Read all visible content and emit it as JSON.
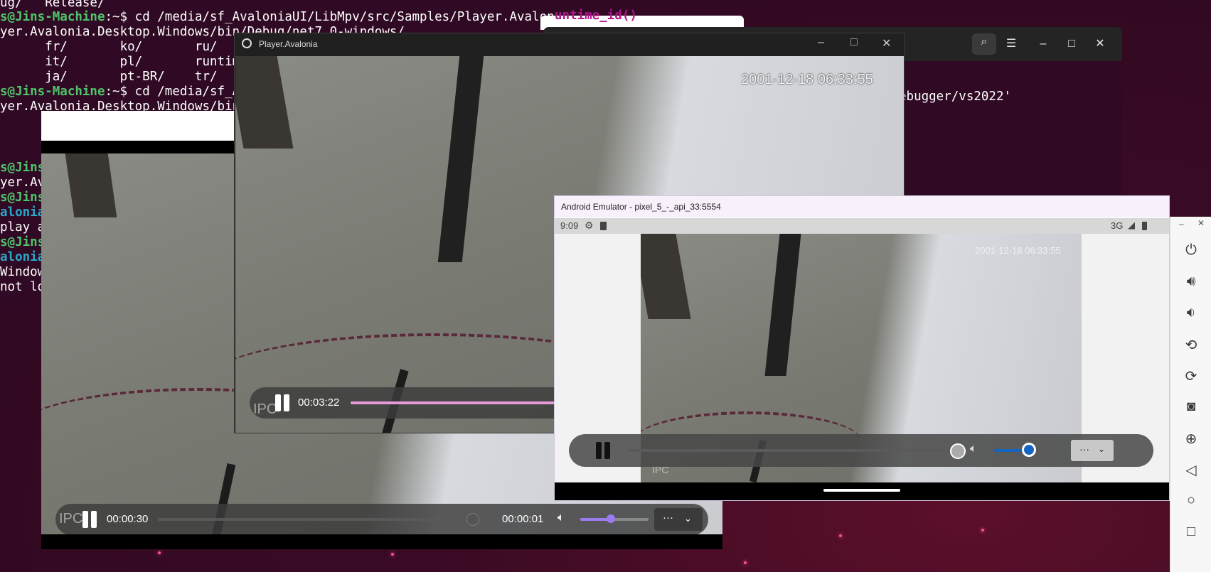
{
  "terminal": {
    "lines": [
      {
        "pre": "ug/   Release/",
        "user": "",
        "rest": ""
      },
      {
        "pre": "",
        "user": "s@Jins-Machine",
        "rest": ":~$ cd /media/sf_AvaloniaUI/LibMpv/src/Samples/Player.Avalonia/"
      },
      {
        "pre": "yer.Avalonia.Desktop.Windows/bin/Debug/net7.0-windows/",
        "user": "",
        "rest": ""
      },
      {
        "pre": "      fr/       ko/       ru/",
        "user": "",
        "rest": ""
      },
      {
        "pre": "      it/       pl/       runtime",
        "user": "",
        "rest": ""
      },
      {
        "pre": "      ja/       pt-BR/    tr/",
        "user": "",
        "rest": ""
      },
      {
        "pre": "",
        "user": "s@Jins-Machine",
        "rest": ":~$ cd /media/sf_Ava"
      },
      {
        "pre": "yer.Avalonia.Desktop.Windows/bin/D",
        "user": "",
        "rest": ""
      }
    ],
    "lower_lines": [
      "s@Jins",
      "yer.Ava",
      "s@Jins",
      "alonia.",
      "play al",
      "s@Jins",
      "alonia.",
      "Windows",
      "not loa"
    ]
  },
  "right_terminal": {
    "text": "ebugger/vs2022'",
    "card_text": "untime_id()"
  },
  "player_left": {
    "current_time": "00:00:30",
    "remaining_time": "00:00:01",
    "more_label": "···",
    "watermark": "IPC",
    "progress": 0.92,
    "volume": 0.45
  },
  "player_avalonia": {
    "title": "Player.Avalonia",
    "timestamp": "2001-12-18 06:33:55",
    "current_time": "00:03:22",
    "watermark": "IPC",
    "accent": "#e79ad9"
  },
  "android": {
    "title": "Android Emulator - pixel_5_-_api_33:5554",
    "clock": "9:09",
    "network": "3G",
    "timestamp": "2001-12-18 06:33:55",
    "watermark": "IPC",
    "more_label": "···",
    "progress": 1.0,
    "volume": 0.5,
    "accent": "#1565c0"
  },
  "side_toolbar": {
    "icons": [
      "power-icon",
      "volume-up-icon",
      "volume-down-icon",
      "rotate-left-icon",
      "rotate-right-icon",
      "camera-icon",
      "zoom-icon",
      "back-icon",
      "home-icon",
      "overview-icon"
    ]
  }
}
